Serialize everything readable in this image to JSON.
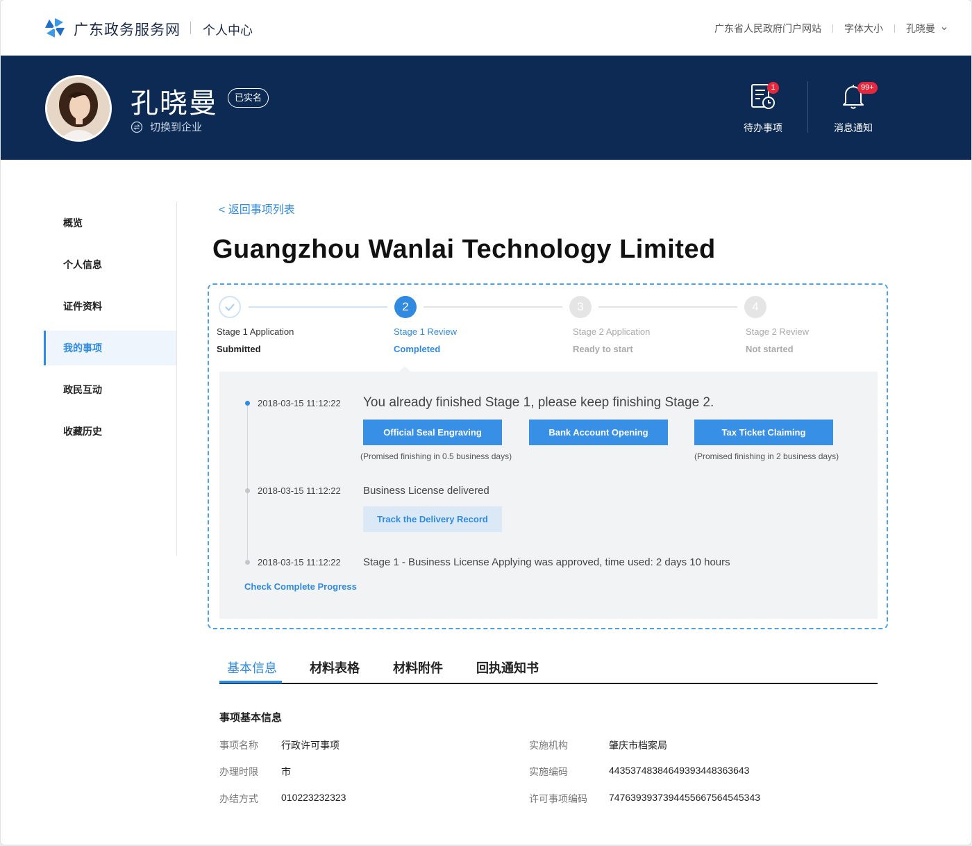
{
  "topbar": {
    "site_name": "广东政务服务网",
    "center_name": "个人中心",
    "links": [
      "广东省人民政府门户网站",
      "字体大小"
    ],
    "user": "孔晓曼",
    "brand_color": "#2f8ae0"
  },
  "header": {
    "user_name": "孔晓曼",
    "verified_label": "已实名",
    "switch_label": "切换到企业",
    "todo": {
      "label": "待办事项",
      "badge": "1"
    },
    "notice": {
      "label": "消息通知",
      "badge": "99+"
    },
    "band_color": "#0c2a54"
  },
  "sidebar": {
    "items": [
      {
        "label": "概览"
      },
      {
        "label": "个人信息"
      },
      {
        "label": "证件资料"
      },
      {
        "label": "我的事项"
      },
      {
        "label": "政民互动"
      },
      {
        "label": "收藏历史"
      }
    ],
    "active_index": 3
  },
  "main": {
    "back_label": "< 返回事项列表",
    "title": "Guangzhou Wanlai Technology Limited",
    "steps": [
      {
        "number": "✓",
        "name": "Stage 1 Application",
        "status": "Submitted"
      },
      {
        "number": "2",
        "name": "Stage 1 Review",
        "status": "Completed"
      },
      {
        "number": "3",
        "name": "Stage 2 Application",
        "status": "Ready to start"
      },
      {
        "number": "4",
        "name": "Stage 2 Review",
        "status": "Not started"
      }
    ],
    "timeline": [
      {
        "time": "2018-03-15 11:12:22",
        "message": "You already finished Stage 1, please keep finishing Stage 2."
      },
      {
        "time": "2018-03-15 11:12:22",
        "message": "Business License delivered"
      },
      {
        "time": "2018-03-15 11:12:22",
        "message": "Stage 1 - Business License Applying was approved, time used: 2 days 10 hours"
      }
    ],
    "actions": [
      {
        "label": "Official Seal Engraving",
        "hint": "(Promised finishing in 0.5 business days)"
      },
      {
        "label": "Bank Account Opening",
        "hint": ""
      },
      {
        "label": "Tax Ticket Claiming",
        "hint": "(Promised finishing in 2 business days)"
      }
    ],
    "track_label": "Track the Delivery Record",
    "check_progress_label": "Check Complete Progress"
  },
  "tabs": [
    {
      "label": "基本信息"
    },
    {
      "label": "材料表格"
    },
    {
      "label": "材料附件"
    },
    {
      "label": "回执通知书"
    }
  ],
  "basic_info": {
    "section_title": "事项基本信息",
    "left": [
      {
        "key": "事项名称",
        "value": "行政许可事项"
      },
      {
        "key": "办理时限",
        "value": "市"
      },
      {
        "key": "办结方式",
        "value": "010223232323"
      }
    ],
    "right": [
      {
        "key": "实施机构",
        "value": "肇庆市档案局"
      },
      {
        "key": "实施编码",
        "value": "4435374838464939344836364­3"
      },
      {
        "key": "许可事项编码",
        "value": "747639393739445566756454534­3"
      }
    ]
  }
}
